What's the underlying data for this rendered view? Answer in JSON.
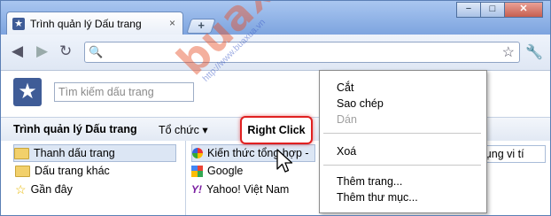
{
  "window": {
    "tab_title": "Trình quản lý Dấu trang",
    "tab_close": "×",
    "new_tab": "+",
    "minimize": "−",
    "maximize": "□",
    "close": "✕"
  },
  "toolbar": {
    "back_icon": "back-arrow-icon",
    "forward_icon": "forward-arrow-icon",
    "reload_icon": "reload-icon",
    "address_value": "",
    "star_icon": "star-outline-icon",
    "wrench_icon": "wrench-icon"
  },
  "search": {
    "placeholder": "Tìm kiếm dấu trang"
  },
  "manager": {
    "title": "Trình quản lý Dấu trang",
    "organize_label": "Tổ chức ▾"
  },
  "tree": [
    {
      "label": "Thanh dấu trang",
      "icon": "folder-open-icon",
      "selected": true
    },
    {
      "label": "Dấu trang khác",
      "icon": "folder-icon",
      "selected": false
    },
    {
      "label": "Gần đây",
      "icon": "star-icon",
      "selected": false
    }
  ],
  "list": [
    {
      "label": "Kiến thức tổng hợp -",
      "icon": "site-favicon"
    },
    {
      "label": "Google",
      "icon": "google-favicon"
    },
    {
      "label": "Yahoo! Việt Nam",
      "icon": "yahoo-favicon"
    }
  ],
  "list_cut_item": "ử dụng vi tí",
  "context_menu": {
    "cut": "Cắt",
    "copy": "Sao chép",
    "paste": "Dán",
    "delete": "Xoá",
    "add_page": "Thêm trang...",
    "add_folder": "Thêm thư mục..."
  },
  "callout": {
    "label": "Right Click"
  },
  "watermark": {
    "big": "buaxua",
    "small": "http://www.buaxua.vn"
  },
  "colors": {
    "accent": "#3f5c97",
    "callout_border": "#e02020",
    "watermark": "#e65028"
  }
}
